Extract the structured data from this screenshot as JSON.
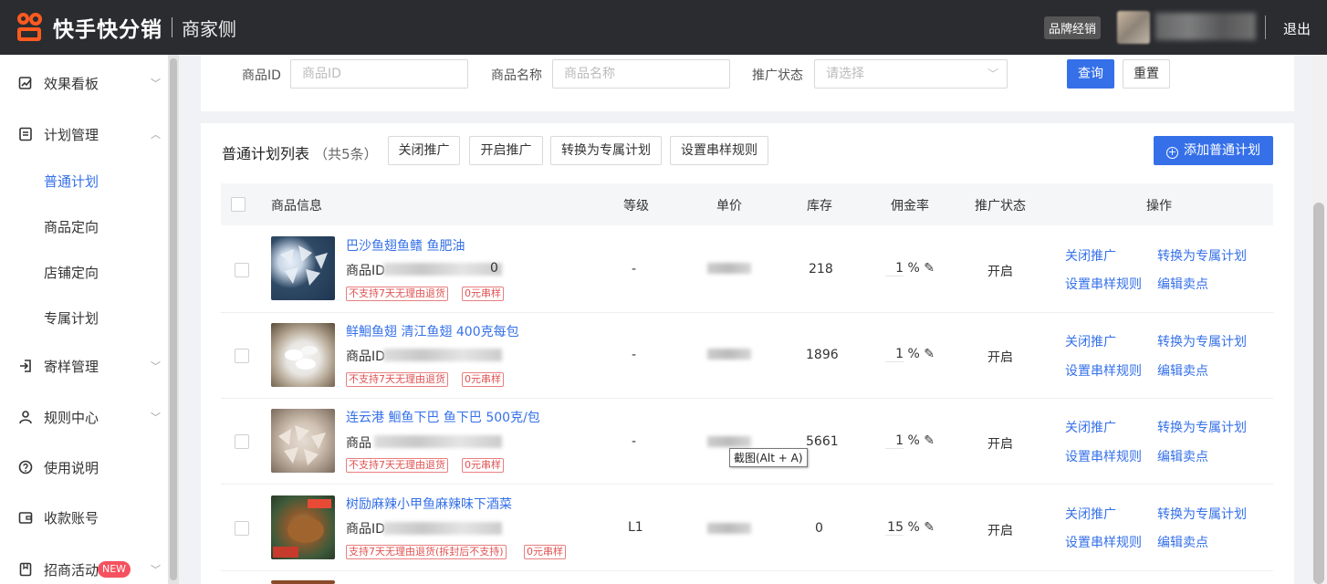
{
  "header": {
    "brand": "快手快分销",
    "sub": "商家侧",
    "role_badge": "品牌经销",
    "logout": "退出"
  },
  "sidebar": {
    "items": [
      {
        "label": "效果看板",
        "icon": "chart-icon"
      },
      {
        "label": "计划管理",
        "icon": "document-icon"
      },
      {
        "label": "寄样管理",
        "icon": "login-icon"
      },
      {
        "label": "规则中心",
        "icon": "user-icon"
      },
      {
        "label": "使用说明",
        "icon": "question-icon"
      },
      {
        "label": "收款账号",
        "icon": "wallet-icon"
      },
      {
        "label": "招商活动",
        "icon": "bookmark-icon",
        "badge": "NEW"
      }
    ],
    "sub_items": [
      "普通计划",
      "商品定向",
      "店铺定向",
      "专属计划"
    ]
  },
  "filter": {
    "product_id_label": "商品ID",
    "product_id_placeholder": "商品ID",
    "product_name_label": "商品名称",
    "product_name_placeholder": "商品名称",
    "status_label": "推广状态",
    "status_placeholder": "请选择",
    "query": "查询",
    "reset": "重置"
  },
  "list": {
    "title": "普通计划列表",
    "count": "（共5条）",
    "toolbar": [
      "关闭推广",
      "开启推广",
      "转换为专属计划",
      "设置串样规则"
    ],
    "add_button": "添加普通计划",
    "columns": [
      "商品信息",
      "等级",
      "单价",
      "库存",
      "佣金率",
      "推广状态",
      "操作"
    ],
    "rows": [
      {
        "name": "巴沙鱼翅鱼鳍 鱼肥油",
        "pid_label": "商品ID",
        "pid_tail": "0",
        "tags": [
          "不支持7天无理由退货",
          "0元串样"
        ],
        "level": "-",
        "stock": "218",
        "rate": "1",
        "rate_unit": "%",
        "status": "开启",
        "actions": [
          "关闭推广",
          "转换为专属计划",
          "设置串样规则",
          "编辑卖点"
        ]
      },
      {
        "name": "鲜鮰鱼翅 清江鱼翅 400克每包",
        "pid_label": "商品ID",
        "pid_tail": "",
        "tags": [
          "不支持7天无理由退货",
          "0元串样"
        ],
        "level": "-",
        "stock": "1896",
        "rate": "1",
        "rate_unit": "%",
        "status": "开启",
        "actions": [
          "关闭推广",
          "转换为专属计划",
          "设置串样规则",
          "编辑卖点"
        ]
      },
      {
        "name": "连云港 鮰鱼下巴 鱼下巴 500克/包",
        "pid_label": "商品",
        "pid_tail": "",
        "tags": [
          "不支持7天无理由退货",
          "0元串样"
        ],
        "level": "-",
        "stock": "5661",
        "rate": "1",
        "rate_unit": "%",
        "status": "开启",
        "actions": [
          "关闭推广",
          "转换为专属计划",
          "设置串样规则",
          "编辑卖点"
        ]
      },
      {
        "name": "树励麻辣小甲鱼麻辣味下酒菜",
        "pid_label": "商品ID",
        "pid_tail": "",
        "tags": [
          "支持7天无理由退货(拆封后不支持)",
          "0元串样"
        ],
        "level": "L1",
        "stock": "0",
        "rate": "15",
        "rate_unit": "%",
        "status": "开启",
        "actions": [
          "关闭推广",
          "转换为专属计划",
          "设置串样规则",
          "编辑卖点"
        ]
      }
    ]
  },
  "tooltip": "截图(Alt + A)",
  "colors": {
    "accent": "#3570e9",
    "topbar": "#2b2c30",
    "brand_orange": "#ff5a1f",
    "tag_red": "#e05252"
  }
}
